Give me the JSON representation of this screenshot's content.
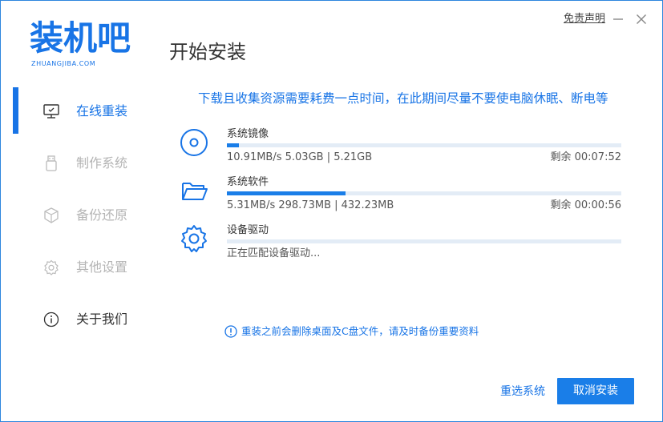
{
  "header": {
    "logo_text": "装机吧",
    "logo_subtext": "ZHUANGJIBA.COM",
    "page_title": "开始安装",
    "disclaimer_label": "免责声明"
  },
  "window_controls": {
    "minimize_icon": "minimize-icon",
    "close_icon": "close-icon"
  },
  "sidebar": {
    "items": [
      {
        "label": "在线重装",
        "icon": "monitor-icon",
        "state": "active"
      },
      {
        "label": "制作系统",
        "icon": "usb-drive-icon",
        "state": "disabled"
      },
      {
        "label": "备份还原",
        "icon": "backup-cube-icon",
        "state": "disabled"
      },
      {
        "label": "其他设置",
        "icon": "gear-icon",
        "state": "disabled"
      },
      {
        "label": "关于我们",
        "icon": "info-icon",
        "state": "normal"
      }
    ]
  },
  "main": {
    "notice": "下载且收集资源需要耗费一点时间，在此期间尽量不要使电脑休眠、断电等",
    "tasks": [
      {
        "name": "系统镜像",
        "icon": "disc-icon",
        "detail": "10.91MB/s 5.03GB | 5.21GB",
        "remaining": "剩余 00:07:52",
        "progress": 0.03
      },
      {
        "name": "系统软件",
        "icon": "folder-icon",
        "detail": "5.31MB/s 298.73MB | 432.23MB",
        "remaining": "剩余 00:00:56",
        "progress": 0.3
      },
      {
        "name": "设备驱动",
        "icon": "gear-icon",
        "detail": "正在匹配设备驱动...",
        "remaining": "",
        "progress": 0
      }
    ],
    "warning": "重装之前会删除桌面及C盘文件，请及时备份重要资料"
  },
  "footer": {
    "reselect_label": "重选系统",
    "cancel_label": "取消安装"
  },
  "colors": {
    "accent": "#1874e6",
    "progress_fill": "#1a7ee8",
    "progress_track": "#e3ecf6",
    "disabled_text": "#b4b4b4"
  }
}
